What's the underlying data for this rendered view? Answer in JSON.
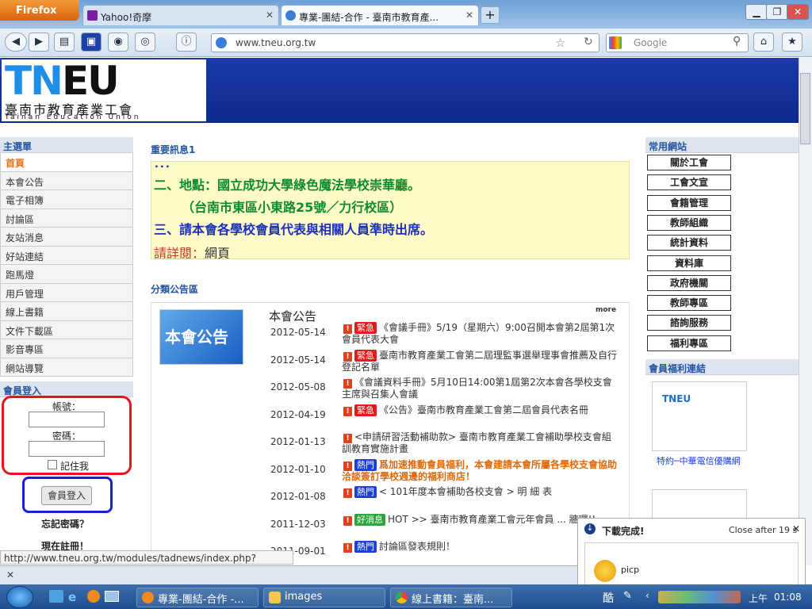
{
  "browser": {
    "menu_button": "Firefox",
    "tabs": [
      {
        "title": "Yahoo!奇摩",
        "active": false
      },
      {
        "title": "專業-團結-合作 - 臺南市教育產...",
        "active": true
      }
    ],
    "url": "www.tneu.org.tw",
    "search_placeholder": "Google",
    "status_url": "http://www.tneu.org.tw/modules/tadnews/index.php?nsn=149"
  },
  "site": {
    "logo_letters": "TNEU",
    "logo_cn": "臺南市教育產業工會",
    "logo_en": "Tainan Education Union"
  },
  "left": {
    "menu_title": "主選單",
    "menu": [
      "首頁",
      "本會公告",
      "電子相簿",
      "討論區",
      "友站消息",
      "好站連結",
      "跑馬燈",
      "用戶管理",
      "線上書籍",
      "文件下載區",
      "影音專區",
      "網站導覽"
    ],
    "login_title": "會員登入",
    "account_label": "帳號：",
    "password_label": "密碼：",
    "remember_label": "記住我",
    "login_button": "會員登入",
    "forgot": "忘記密碼？",
    "register": "現在註冊！"
  },
  "main": {
    "notice_title": "重要訊息1",
    "notice_lines": [
      "二、地點：國立成功大學綠色魔法學校崇華廳。",
      "（台南市東區小東路25號／力行校區）",
      "三、請本會各學校會員代表與相關人員準時出席。"
    ],
    "notice_more_label": "請詳閱：",
    "notice_more_link": "網頁",
    "cat_title": "分類公告區",
    "cat_name": "本會公告",
    "cat_img_text": "本會公告",
    "more": "more",
    "news": [
      {
        "date": "2012-05-14",
        "badge": "緊急",
        "badge_color": "red",
        "text": "《會議手冊》5/19（星期六）9:00召開本會第2屆第1次會員代表大會"
      },
      {
        "date": "2012-05-14",
        "badge": "緊急",
        "badge_color": "red",
        "text": "臺南市教育產業工會第二屆理監事選舉理事會推薦及自行登記名單"
      },
      {
        "date": "2012-05-08",
        "badge": "",
        "badge_color": "",
        "text": "《會議資料手冊》5月10日14:00第1屆第2次本會各學校支會主席與召集人會議"
      },
      {
        "date": "2012-04-19",
        "badge": "緊急",
        "badge_color": "red",
        "text": "《公告》臺南市教育產業工會第二屆會員代表名冊"
      },
      {
        "date": "2012-01-13",
        "badge": "",
        "badge_color": "",
        "text": "<申請研習活動補助款> 臺南市教育產業工會補助學校支會組訓教育實施計畫"
      },
      {
        "date": "2012-01-10",
        "badge": "熱門",
        "badge_color": "blue",
        "text": "爲加速推動會員福利，本會建請本會所屬各學校支會協助洽談簽訂學校週邊的福利商店！"
      },
      {
        "date": "2012-01-08",
        "badge": "熱門",
        "badge_color": "blue",
        "text": "< 101年度本會補助各校支會 > 明 細 表"
      },
      {
        "date": "2011-12-03",
        "badge": "好消息",
        "badge_color": "green",
        "text": "HOT >> 臺南市教育產業工會元年會員 ... 牆囉!!"
      },
      {
        "date": "2011-09-01",
        "badge": "熱門",
        "badge_color": "blue",
        "text": "討論區發表規則！"
      }
    ]
  },
  "right": {
    "links_title": "常用網站",
    "links": [
      "關於工會",
      "工會文宣",
      "會籍管理",
      "教師組織",
      "統計資料",
      "資料庫",
      "政府機關",
      "教師專區",
      "諮詢服務",
      "福利專區"
    ],
    "welfare_title": "會員福利連結",
    "welfare_caption": "特約─中華電信優購網",
    "welfare_img_text": "TNEU"
  },
  "download": {
    "title": "下載完成!",
    "close_after": "Close after 19 s",
    "file": "picp"
  },
  "taskbar": {
    "items": [
      "專業-團結-合作 -...",
      "images",
      "線上書籍：臺南..."
    ],
    "ime": "酷",
    "time_prefix": "上午",
    "time": "01:08"
  }
}
